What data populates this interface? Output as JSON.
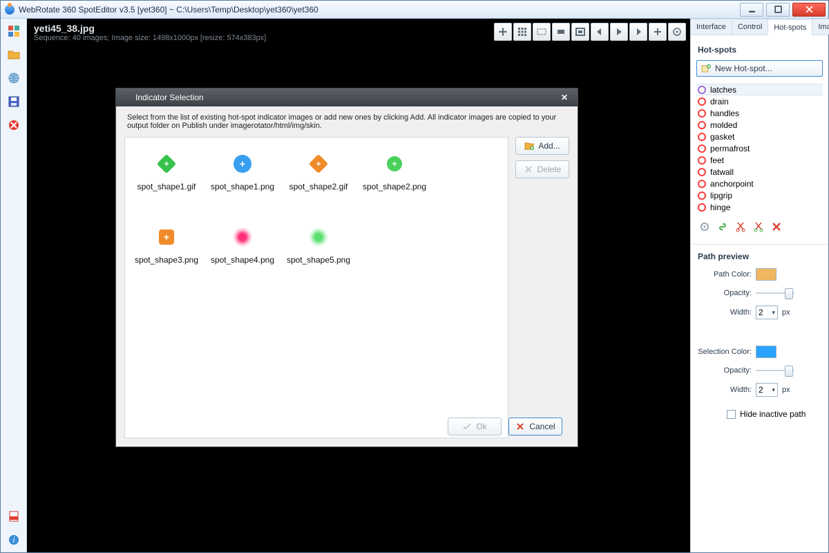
{
  "window": {
    "title": "WebRotate 360 SpotEditor v3.5 [yet360]  ~  C:\\Users\\Temp\\Desktop\\yet360\\yet360"
  },
  "stage": {
    "filename": "yeti45_38.jpg",
    "info": "Sequence: 40 images; Image size: 1498x1000px [resize: 574x383px]"
  },
  "tabs": [
    "Interface",
    "Control",
    "Hot-spots",
    "Images"
  ],
  "activeTab": "Hot-spots",
  "hotspots": {
    "heading": "Hot-spots",
    "newBtn": "New Hot-spot...",
    "items": [
      {
        "label": "latches",
        "sel": true,
        "color": "purple"
      },
      {
        "label": "drain"
      },
      {
        "label": "handles"
      },
      {
        "label": "molded"
      },
      {
        "label": "gasket"
      },
      {
        "label": "permafrost"
      },
      {
        "label": "feet"
      },
      {
        "label": "fatwall"
      },
      {
        "label": "anchorpoint"
      },
      {
        "label": "lipgrip"
      },
      {
        "label": "hinge"
      }
    ]
  },
  "pathPreview": {
    "heading": "Path preview",
    "pathColor": {
      "label": "Path Color:",
      "hex": "#f0b760"
    },
    "opacity1": {
      "label": "Opacity:"
    },
    "width1": {
      "label": "Width:",
      "value": "2",
      "unit": "px"
    },
    "selColor": {
      "label": "Selection Color:",
      "hex": "#2aa3ff"
    },
    "opacity2": {
      "label": "Opacity:"
    },
    "width2": {
      "label": "Width:",
      "value": "2",
      "unit": "px"
    },
    "hideInactive": "Hide inactive path"
  },
  "modal": {
    "title": "Indicator Selection",
    "desc": "Select from the list of existing hot-spot indicator images or add new ones by clicking Add. All indicator images are copied to your output folder on Publish under imagerotator/html/img/skin.",
    "addBtn": "Add...",
    "delBtn": "Delete",
    "okBtn": "Ok",
    "cancelBtn": "Cancel",
    "shapes": [
      {
        "file": "spot_shape1.gif",
        "kind": "diamond-green"
      },
      {
        "file": "spot_shape1.png",
        "kind": "circle-blue"
      },
      {
        "file": "spot_shape2.gif",
        "kind": "diamond-orange"
      },
      {
        "file": "spot_shape2.png",
        "kind": "circle-green"
      },
      {
        "file": "spot_shape3.png",
        "kind": "square-orange"
      },
      {
        "file": "spot_shape4.png",
        "kind": "glow-pink"
      },
      {
        "file": "spot_shape5.png",
        "kind": "glow-green"
      }
    ]
  }
}
